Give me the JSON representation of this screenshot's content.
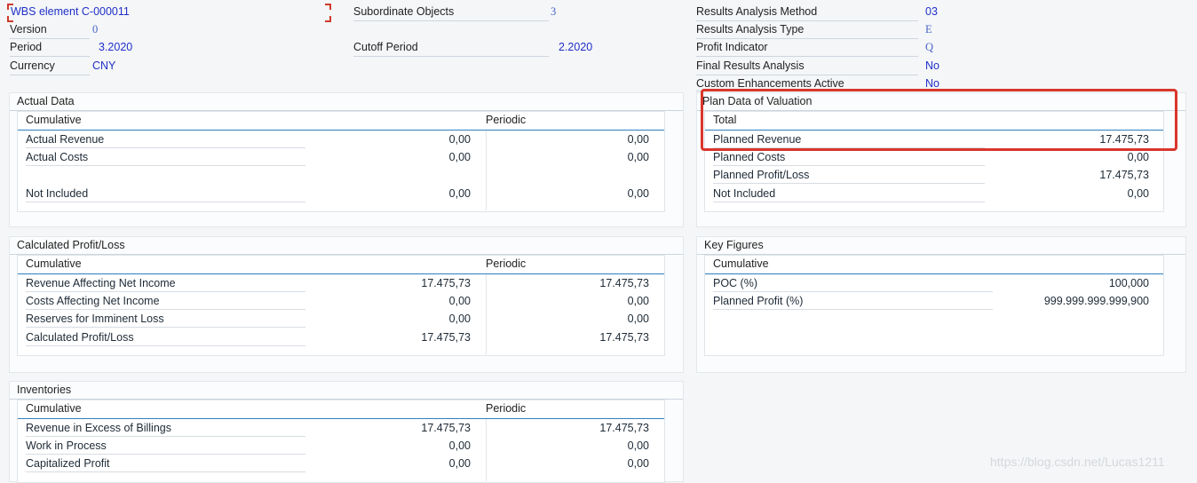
{
  "header": {
    "wbs_element": "WBS element C-000011",
    "version_label": "Version",
    "version_value": "0",
    "period_label": "Period",
    "period_value": "3.2020",
    "currency_label": "Currency",
    "currency_value": "CNY",
    "subordinate_label": "Subordinate Objects",
    "subordinate_value": "3",
    "cutoff_label": "Cutoff Period",
    "cutoff_value": "2.2020",
    "ra_method_label": "Results Analysis Method",
    "ra_method_value": "03",
    "ra_type_label": "Results Analysis Type",
    "ra_type_value": "E",
    "profit_indicator_label": "Profit Indicator",
    "profit_indicator_value": "Q",
    "final_ra_label": "Final Results Analysis",
    "final_ra_value": "No",
    "custom_enh_label": "Custom Enhancements Active",
    "custom_enh_value": "No"
  },
  "actual_data": {
    "title": "Actual Data",
    "col_cumulative": "Cumulative",
    "col_periodic": "Periodic",
    "rows": [
      {
        "label": "Actual Revenue",
        "cumulative": "0,00",
        "periodic": "0,00"
      },
      {
        "label": "Actual Costs",
        "cumulative": "0,00",
        "periodic": "0,00"
      },
      {
        "label": "Not Included",
        "cumulative": "0,00",
        "periodic": "0,00"
      }
    ]
  },
  "plan_data": {
    "title": "Plan Data of Valuation",
    "col_total": "Total",
    "rows": [
      {
        "label": "Planned Revenue",
        "total": "17.475,73"
      },
      {
        "label": "Planned Costs",
        "total": "0,00"
      },
      {
        "label": "Planned Profit/Loss",
        "total": "17.475,73"
      },
      {
        "label": "Not Included",
        "total": "0,00"
      }
    ]
  },
  "calc_pl": {
    "title": "Calculated Profit/Loss",
    "col_cumulative": "Cumulative",
    "col_periodic": "Periodic",
    "rows": [
      {
        "label": "Revenue Affecting Net Income",
        "cumulative": "17.475,73",
        "periodic": "17.475,73"
      },
      {
        "label": "Costs Affecting Net Income",
        "cumulative": "0,00",
        "periodic": "0,00"
      },
      {
        "label": "Reserves for Imminent Loss",
        "cumulative": "0,00",
        "periodic": "0,00"
      },
      {
        "label": "Calculated Profit/Loss",
        "cumulative": "17.475,73",
        "periodic": "17.475,73"
      }
    ]
  },
  "key_figures": {
    "title": "Key Figures",
    "col_cumulative": "Cumulative",
    "rows": [
      {
        "label": "POC (%)",
        "value": "100,000"
      },
      {
        "label": "Planned Profit (%)",
        "value": "999.999.999.999,900"
      }
    ]
  },
  "inventories": {
    "title": "Inventories",
    "col_cumulative": "Cumulative",
    "col_periodic": "Periodic",
    "rows": [
      {
        "label": "Revenue in Excess of Billings",
        "cumulative": "17.475,73",
        "periodic": "17.475,73"
      },
      {
        "label": "Work in Process",
        "cumulative": "0,00",
        "periodic": "0,00"
      },
      {
        "label": "Capitalized Profit",
        "cumulative": "0,00",
        "periodic": "0,00"
      }
    ]
  },
  "watermark": "https://blog.csdn.net/Lucas1211",
  "colors": {
    "highlight": "#d9362b",
    "value_blue": "#2030c8",
    "accent_rule": "#2f7fbf"
  }
}
